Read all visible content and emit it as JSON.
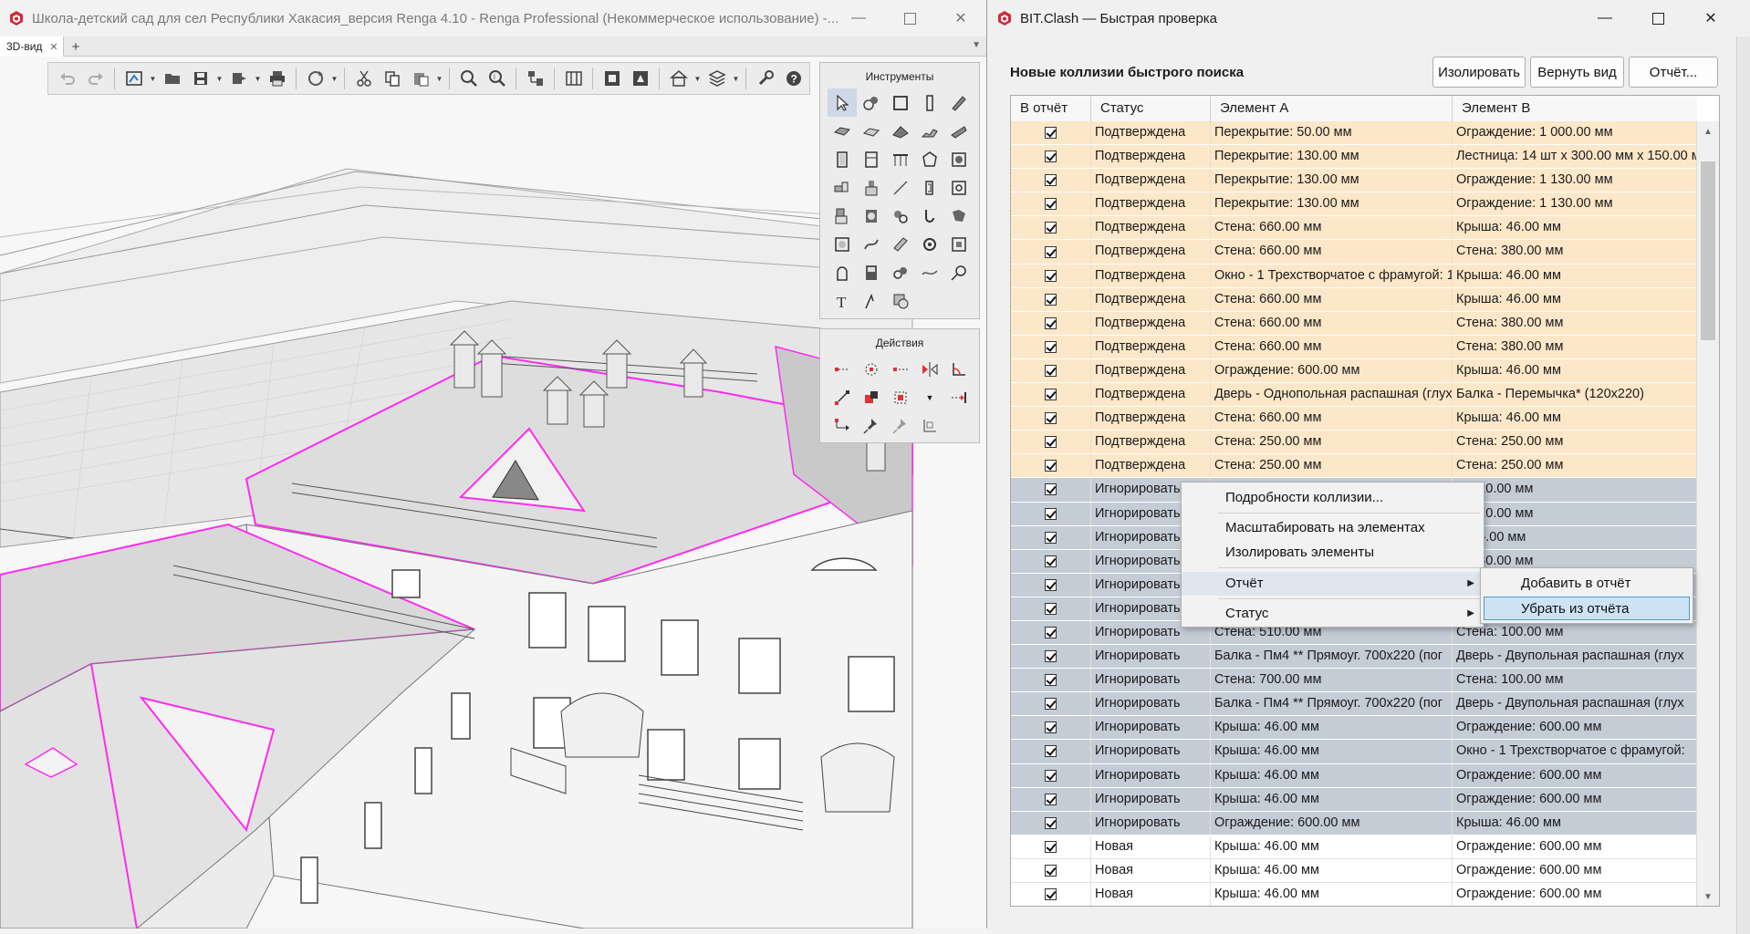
{
  "renga": {
    "title": "Школа-детский сад для сел Республики Хакасия_версия Renga 4.10 - Renga Professional (Некоммерческое использование) -...",
    "tab_label": "3D-вид",
    "tab_close": "✕",
    "tab_add": "+",
    "panels": {
      "tools_title": "Инструменты",
      "actions_title": "Действия"
    }
  },
  "clash": {
    "title": "BIT.Clash — Быстрая проверка",
    "section_title": "Новые коллизии быстрого поиска",
    "buttons": {
      "isolate": "Изолировать",
      "restore_view": "Вернуть вид",
      "report": "Отчёт..."
    },
    "columns": [
      "В отчёт",
      "Статус",
      "Элемент А",
      "Элемент В"
    ],
    "rows": [
      {
        "status": "Подтверждена",
        "a": "Перекрытие: 50.00 мм",
        "b": "Ограждение: 1 000.00 мм",
        "kind": "confirmed"
      },
      {
        "status": "Подтверждена",
        "a": "Перекрытие: 130.00 мм",
        "b": "Лестница: 14 шт х 300.00 мм х 150.00 мм",
        "kind": "confirmed"
      },
      {
        "status": "Подтверждена",
        "a": "Перекрытие: 130.00 мм",
        "b": "Ограждение: 1 130.00 мм",
        "kind": "confirmed"
      },
      {
        "status": "Подтверждена",
        "a": "Перекрытие: 130.00 мм",
        "b": "Ограждение: 1 130.00 мм",
        "kind": "confirmed"
      },
      {
        "status": "Подтверждена",
        "a": "Стена: 660.00 мм",
        "b": "Крыша: 46.00 мм",
        "kind": "confirmed"
      },
      {
        "status": "Подтверждена",
        "a": "Стена: 660.00 мм",
        "b": "Стена: 380.00 мм",
        "kind": "confirmed"
      },
      {
        "status": "Подтверждена",
        "a": "Окно - 1 Трехстворчатое с фрамугой: 1",
        "b": "Крыша: 46.00 мм",
        "kind": "confirmed"
      },
      {
        "status": "Подтверждена",
        "a": "Стена: 660.00 мм",
        "b": "Крыша: 46.00 мм",
        "kind": "confirmed"
      },
      {
        "status": "Подтверждена",
        "a": "Стена: 660.00 мм",
        "b": "Стена: 380.00 мм",
        "kind": "confirmed"
      },
      {
        "status": "Подтверждена",
        "a": "Стена: 660.00 мм",
        "b": "Стена: 380.00 мм",
        "kind": "confirmed"
      },
      {
        "status": "Подтверждена",
        "a": "Ограждение: 600.00 мм",
        "b": "Крыша: 46.00 мм",
        "kind": "confirmed"
      },
      {
        "status": "Подтверждена",
        "a": "Дверь - Однопольная распашная (глух",
        "b": "Балка - Перемычка* (120х220)",
        "kind": "confirmed"
      },
      {
        "status": "Подтверждена",
        "a": "Стена: 660.00 мм",
        "b": "Крыша: 46.00 мм",
        "kind": "confirmed"
      },
      {
        "status": "Подтверждена",
        "a": "Стена: 250.00 мм",
        "b": "Стена: 250.00 мм",
        "kind": "confirmed"
      },
      {
        "status": "Подтверждена",
        "a": "Стена: 250.00 мм",
        "b": "Стена: 250.00 мм",
        "kind": "confirmed"
      },
      {
        "status": "Игнорировать",
        "a": "",
        "b": "а: 120.00 мм",
        "kind": "ignored"
      },
      {
        "status": "Игнорировать",
        "a": "",
        "b": "а: 120.00 мм",
        "kind": "ignored"
      },
      {
        "status": "Игнорировать",
        "a": "",
        "b": "а: 16.00 мм",
        "kind": "ignored"
      },
      {
        "status": "Игнорировать",
        "a": "",
        "b": "а: 380.00 мм",
        "kind": "ignored"
      },
      {
        "status": "Игнорировать",
        "a": "",
        "b": "",
        "kind": "ignored"
      },
      {
        "status": "Игнорировать",
        "a": "",
        "b": "",
        "kind": "ignored"
      },
      {
        "status": "Игнорировать",
        "a": "Стена: 510.00 мм",
        "b": "Стена: 100.00 мм",
        "kind": "ignored"
      },
      {
        "status": "Игнорировать",
        "a": "Балка - Пм4 ** Прямоуг. 700х220 (пог",
        "b": "Дверь - Двупольная распашная (глух",
        "kind": "ignored"
      },
      {
        "status": "Игнорировать",
        "a": "Стена: 700.00 мм",
        "b": "Стена: 100.00 мм",
        "kind": "ignored"
      },
      {
        "status": "Игнорировать",
        "a": "Балка - Пм4 ** Прямоуг. 700х220 (пог",
        "b": "Дверь - Двупольная распашная (глух",
        "kind": "ignored"
      },
      {
        "status": "Игнорировать",
        "a": "Крыша: 46.00 мм",
        "b": "Ограждение: 600.00 мм",
        "kind": "ignored"
      },
      {
        "status": "Игнорировать",
        "a": "Крыша: 46.00 мм",
        "b": "Окно - 1 Трехстворчатое с фрамугой:",
        "kind": "ignored"
      },
      {
        "status": "Игнорировать",
        "a": "Крыша: 46.00 мм",
        "b": "Ограждение: 600.00 мм",
        "kind": "ignored"
      },
      {
        "status": "Игнорировать",
        "a": "Крыша: 46.00 мм",
        "b": "Ограждение: 600.00 мм",
        "kind": "ignored"
      },
      {
        "status": "Игнорировать",
        "a": "Ограждение: 600.00 мм",
        "b": "Крыша: 46.00 мм",
        "kind": "ignored"
      },
      {
        "status": "Новая",
        "a": "Крыша: 46.00 мм",
        "b": "Ограждение: 600.00 мм",
        "kind": "new"
      },
      {
        "status": "Новая",
        "a": "Крыша: 46.00 мм",
        "b": "Ограждение: 600.00 мм",
        "kind": "new"
      },
      {
        "status": "Новая",
        "a": "Крыша: 46.00 мм",
        "b": "Ограждение: 600.00 мм",
        "kind": "new"
      }
    ],
    "context_menu": {
      "details": "Подробности коллизии...",
      "zoom": "Масштабировать на элементах",
      "isolate": "Изолировать элементы",
      "report": "Отчёт",
      "status": "Статус"
    },
    "submenu": {
      "add": "Добавить в отчёт",
      "remove": "Убрать из отчёта"
    }
  },
  "colors": {
    "confirmed_row": "#fde7c9",
    "ignored_row": "#c4ccd6",
    "new_row": "#ffffff",
    "clash_highlight": "#ff2bf0",
    "menu_active": "#cde3f3"
  }
}
